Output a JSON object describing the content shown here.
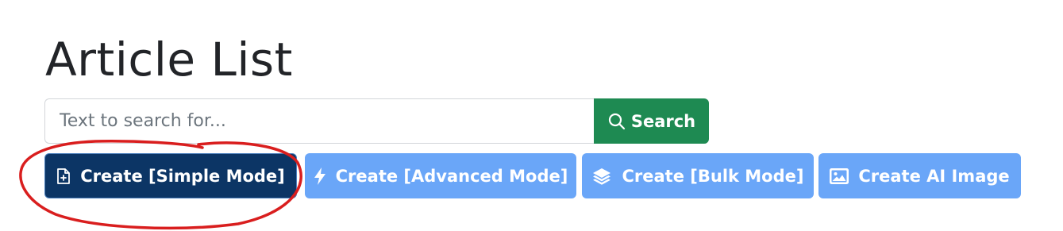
{
  "page": {
    "title": "Article List"
  },
  "search": {
    "placeholder": "Text to search for...",
    "value": "",
    "button_label": "Search",
    "button_icon": "search-icon"
  },
  "actions": [
    {
      "label": "Create [Simple Mode]",
      "icon": "file-plus-icon",
      "style": "primary-dark"
    },
    {
      "label": "Create [Advanced Mode]",
      "icon": "lightning-icon",
      "style": "primary-light"
    },
    {
      "label": "Create [Bulk Mode]",
      "icon": "layers-icon",
      "style": "primary-light"
    },
    {
      "label": "Create AI Image",
      "icon": "image-icon",
      "style": "primary-light"
    }
  ],
  "colors": {
    "search_button": "#1e8a52",
    "active_button": "#0c3565",
    "inactive_button": "#6aa6f8",
    "annotation_circle": "#d91e1e"
  }
}
